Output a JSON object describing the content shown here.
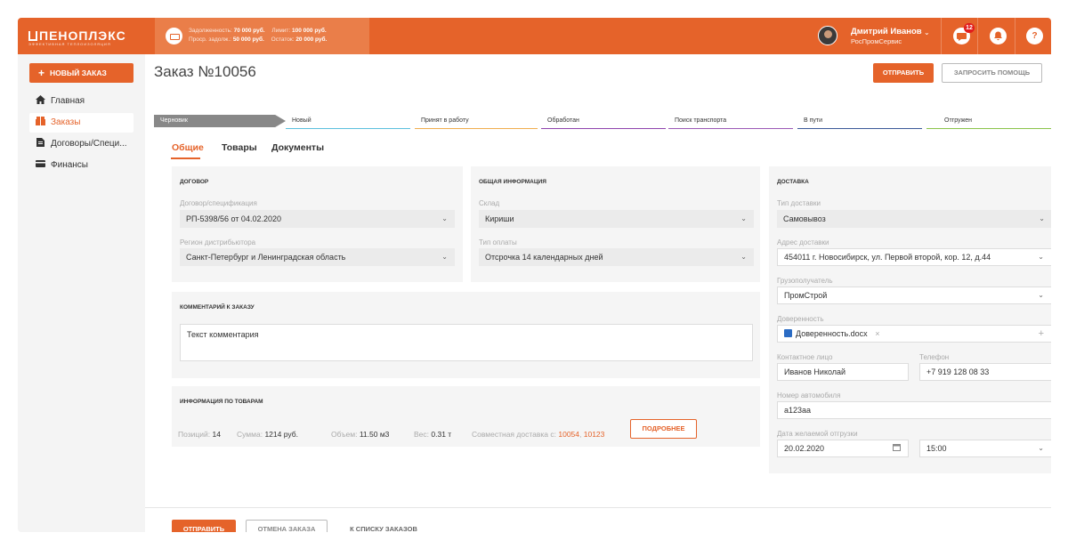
{
  "header": {
    "logo": "ПЕНОПЛЭКС",
    "logo_sub": "ЭФФЕКТИВНАЯ ТЕПЛОИЗОЛЯЦИЯ",
    "credit": {
      "debt_label": "Задолженность:",
      "debt_value": "70 000 руб.",
      "limit_label": "Лимит:",
      "limit_value": "100 000 руб.",
      "overdue_label": "Проср. задолж.:",
      "overdue_value": "50 000 руб.",
      "remaining_label": "Остаток:",
      "remaining_value": "20 000 руб."
    },
    "user": {
      "name": "Дмитрий Иванов",
      "company": "РосПромСервис"
    },
    "messages_count": "12",
    "icons": [
      "wallet-icon",
      "chat-icon",
      "bell-icon",
      "help-icon"
    ]
  },
  "sidebar": {
    "new_order_label": "НОВЫЙ ЗАКАЗ",
    "items": [
      {
        "label": "Главная",
        "icon": "home-icon"
      },
      {
        "label": "Заказы",
        "icon": "box-icon"
      },
      {
        "label": "Договоры/Специ...",
        "icon": "document-icon"
      },
      {
        "label": "Финансы",
        "icon": "card-icon"
      }
    ]
  },
  "main": {
    "title": "Заказ №10056",
    "send_label": "ОТПРАВИТЬ",
    "help_label": "ЗАПРОСИТЬ ПОМОЩЬ",
    "steps": [
      {
        "label": "Черновик",
        "color": "#888888"
      },
      {
        "label": "Новый",
        "color": "#5bc0de"
      },
      {
        "label": "Принят в работу",
        "color": "#f0ad4e"
      },
      {
        "label": "Обработан",
        "color": "#8e44ad"
      },
      {
        "label": "Поиск транспорта",
        "color": "#9b59b6"
      },
      {
        "label": "В пути",
        "color": "#3b5998"
      },
      {
        "label": "Отгружен",
        "color": "#8bc34a"
      }
    ],
    "tabs": [
      "Общие",
      "Товары",
      "Документы"
    ],
    "contract": {
      "title": "ДОГОВОР",
      "spec_label": "Договор/спецификация",
      "spec_value": "РП-5398/56 от 04.02.2020",
      "region_label": "Регион дистрибьютора",
      "region_value": "Санкт-Петербург и Ленинградская область"
    },
    "general": {
      "title": "ОБЩАЯ ИНФОРМАЦИЯ",
      "warehouse_label": "Склад",
      "warehouse_value": "Кириши",
      "payment_label": "Тип оплаты",
      "payment_value": "Отсрочка 14 календарных дней"
    },
    "comment": {
      "title": "КОММЕНТАРИЙ К ЗАКАЗУ",
      "value": "Текст комментария"
    },
    "goods": {
      "title": "ИНФОРМАЦИЯ ПО ТОВАРАМ",
      "positions_label": "Позиций:",
      "positions_value": "14",
      "sum_label": "Сумма:",
      "sum_value": "1214 руб.",
      "volume_label": "Объем:",
      "volume_value": "11.50 м3",
      "weight_label": "Вес:",
      "weight_value": "0.31 т",
      "joint_label": "Совместная доставка с:",
      "joint_orders": [
        "10054",
        "10123"
      ],
      "more_label": "ПОДРОБНЕЕ"
    },
    "delivery": {
      "title": "ДОСТАВКА",
      "type_label": "Тип доставки",
      "type_value": "Самовывоз",
      "address_label": "Адрес доставки",
      "address_value": "454011 г. Новосибирск, ул. Первой второй, кор. 12, д.44",
      "consignee_label": "Грузополучатель",
      "consignee_value": "ПромСтрой",
      "proxy_label": "Доверенность",
      "proxy_file": "Доверенность.docx",
      "contact_label": "Контактное лицо",
      "contact_value": "Иванов Николай",
      "phone_label": "Телефон",
      "phone_value": "+7 919 128 08 33",
      "car_label": "Номер автомобиля",
      "car_value": "а123аа",
      "date_label": "Дата желаемой отгрузки",
      "date_value": "20.02.2020",
      "time_value": "15:00"
    },
    "footer": {
      "send_label": "ОТПРАВИТЬ",
      "cancel_label": "ОТМЕНА ЗАКАЗА",
      "list_label": "К СПИСКУ ЗАКАЗОВ"
    }
  }
}
